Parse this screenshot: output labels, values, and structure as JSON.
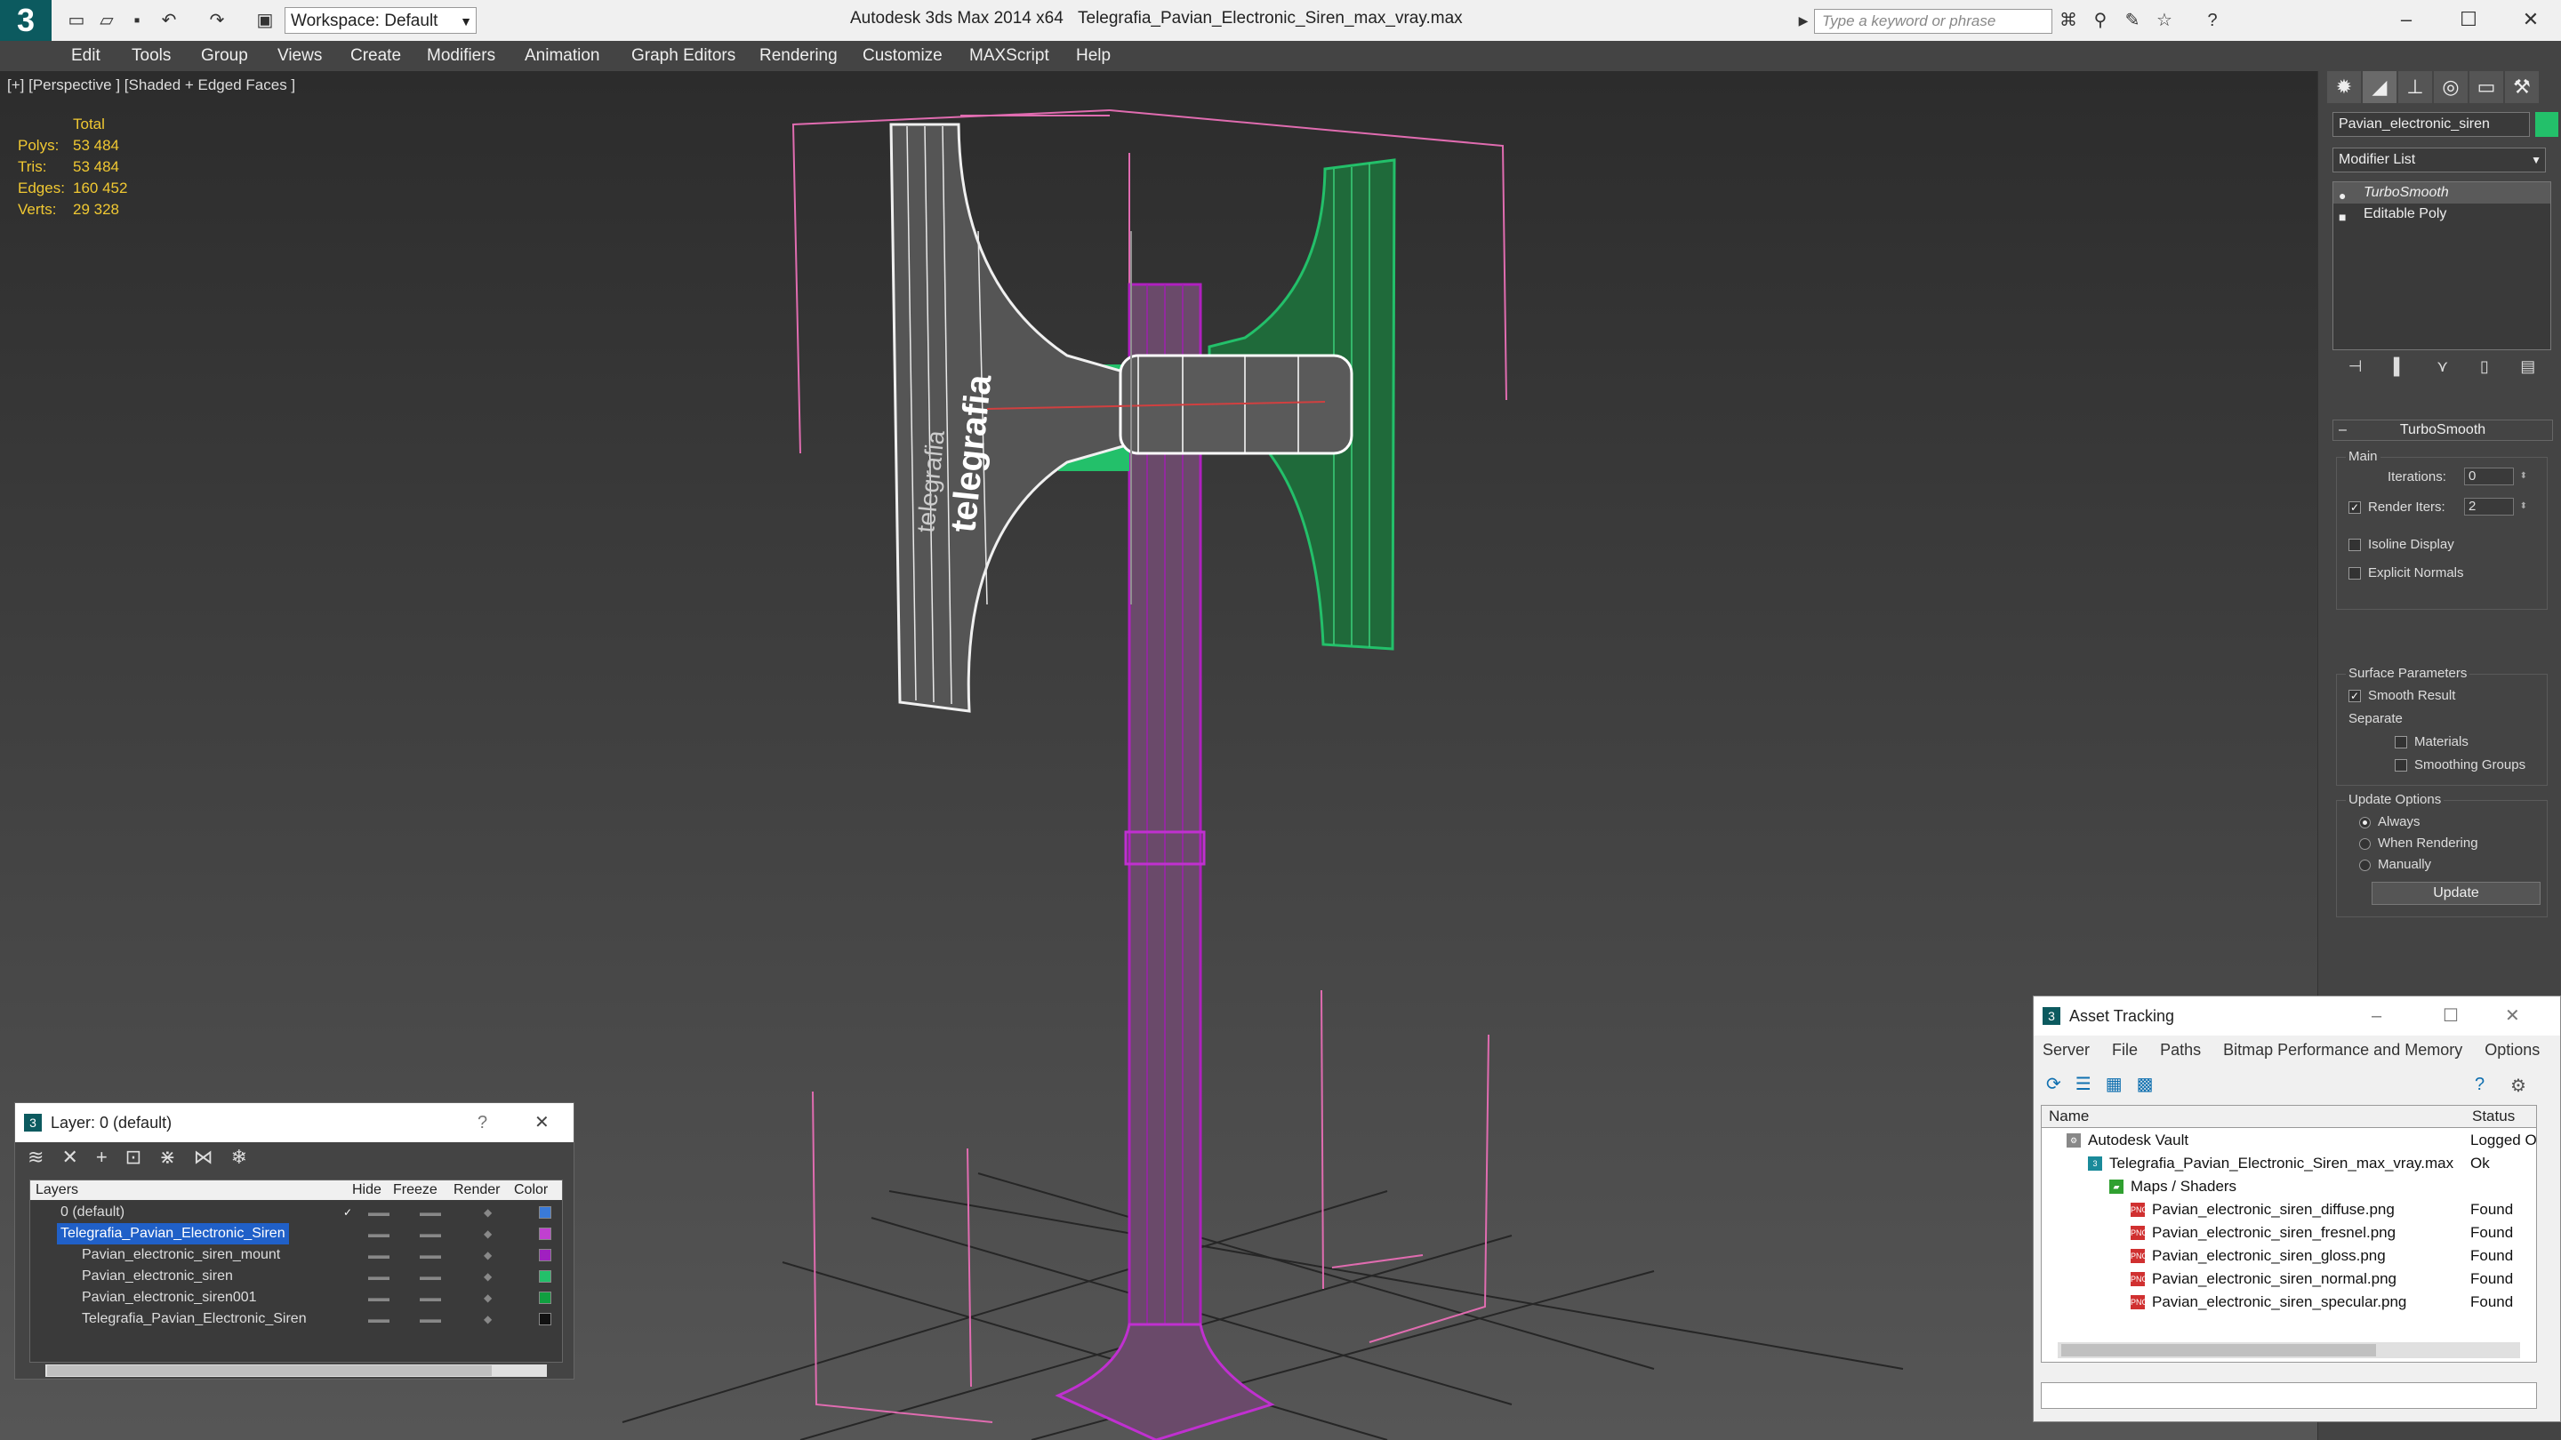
{
  "titlebar": {
    "workspace": "Workspace: Default",
    "app_title": "Autodesk 3ds Max  2014 x64",
    "file_title": "Telegrafia_Pavian_Electronic_Siren_max_vray.max",
    "search_placeholder": "Type a keyword or phrase",
    "icons": [
      "new-icon",
      "open-icon",
      "save-icon",
      "undo-icon",
      "redo-icon",
      "project-icon",
      "search-icon",
      "help-icon"
    ]
  },
  "menu": [
    "Edit",
    "Tools",
    "Group",
    "Views",
    "Create",
    "Modifiers",
    "Animation",
    "Graph Editors",
    "Rendering",
    "Customize",
    "MAXScript",
    "Help"
  ],
  "viewport": {
    "label": "[+] [Perspective ] [Shaded + Edged Faces ]",
    "stats": {
      "total_label": "Total",
      "rows": [
        {
          "label": "Polys:",
          "value": "53 484"
        },
        {
          "label": "Tris:",
          "value": "53 484"
        },
        {
          "label": "Edges:",
          "value": "160 452"
        },
        {
          "label": "Verts:",
          "value": "29 328"
        }
      ]
    }
  },
  "command_panel": {
    "object_name": "Pavian_electronic_siren",
    "object_color": "#23c06a",
    "modifier_list": "Modifier List",
    "stack": [
      "TurboSmooth",
      "Editable Poly"
    ],
    "rollout_title": "TurboSmooth",
    "main_group": "Main",
    "iterations_label": "Iterations:",
    "iterations_value": "0",
    "render_iters_label": "Render Iters:",
    "render_iters_value": "2",
    "isoline": "Isoline Display",
    "explicit_normals": "Explicit Normals",
    "surface_group": "Surface Parameters",
    "smooth_result": "Smooth Result",
    "separate": "Separate",
    "materials": "Materials",
    "smoothing_groups": "Smoothing Groups",
    "update_group": "Update Options",
    "always": "Always",
    "when_rendering": "When Rendering",
    "manually": "Manually",
    "update_button": "Update"
  },
  "layer_window": {
    "title": "Layer: 0 (default)",
    "help": "?",
    "close": "✕",
    "headers": {
      "layers": "Layers",
      "hide": "Hide",
      "freeze": "Freeze",
      "render": "Render",
      "color": "Color"
    },
    "rows": [
      {
        "name": "0 (default)",
        "color": "#3a7ad8"
      },
      {
        "name": "Telegrafia_Pavian_Electronic_Siren",
        "color": "#c040d0"
      },
      {
        "name": "Pavian_electronic_siren_mount",
        "color": "#a020c0"
      },
      {
        "name": "Pavian_electronic_siren",
        "color": "#23c06a"
      },
      {
        "name": "Pavian_electronic_siren001",
        "color": "#10a040"
      },
      {
        "name": "Telegrafia_Pavian_Electronic_Siren",
        "color": "#111111"
      }
    ]
  },
  "asset_window": {
    "title": "Asset Tracking",
    "menu": [
      "Server",
      "File",
      "Paths",
      "Bitmap Performance and Memory",
      "Options"
    ],
    "headers": {
      "name": "Name",
      "status": "Status"
    },
    "rows": [
      {
        "name": "Autodesk Vault",
        "status": "Logged O"
      },
      {
        "name": "Telegrafia_Pavian_Electronic_Siren_max_vray.max",
        "status": "Ok"
      },
      {
        "name": "Maps / Shaders",
        "status": ""
      },
      {
        "name": "Pavian_electronic_siren_diffuse.png",
        "status": "Found"
      },
      {
        "name": "Pavian_electronic_siren_fresnel.png",
        "status": "Found"
      },
      {
        "name": "Pavian_electronic_siren_gloss.png",
        "status": "Found"
      },
      {
        "name": "Pavian_electronic_siren_normal.png",
        "status": "Found"
      },
      {
        "name": "Pavian_electronic_siren_specular.png",
        "status": "Found"
      }
    ]
  }
}
